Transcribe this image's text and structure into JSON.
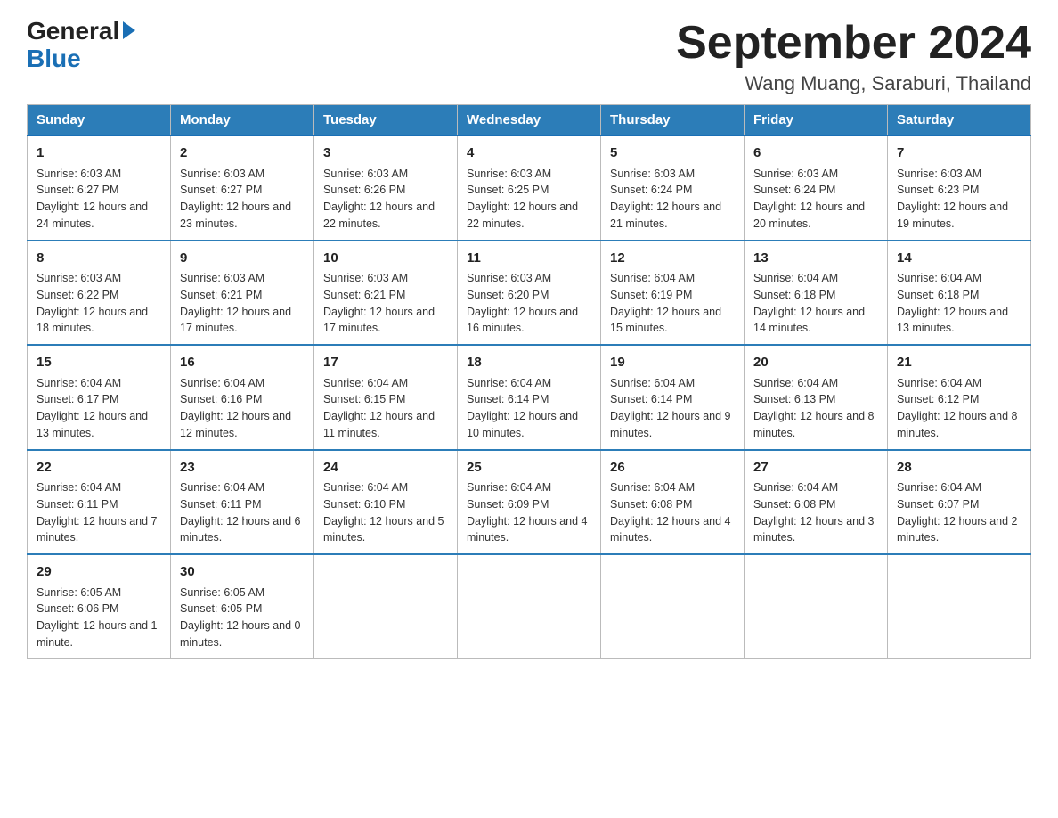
{
  "header": {
    "logo_general": "General",
    "logo_blue": "Blue",
    "month_title": "September 2024",
    "location": "Wang Muang, Saraburi, Thailand"
  },
  "days_of_week": [
    "Sunday",
    "Monday",
    "Tuesday",
    "Wednesday",
    "Thursday",
    "Friday",
    "Saturday"
  ],
  "weeks": [
    [
      {
        "day": "1",
        "sunrise": "Sunrise: 6:03 AM",
        "sunset": "Sunset: 6:27 PM",
        "daylight": "Daylight: 12 hours and 24 minutes."
      },
      {
        "day": "2",
        "sunrise": "Sunrise: 6:03 AM",
        "sunset": "Sunset: 6:27 PM",
        "daylight": "Daylight: 12 hours and 23 minutes."
      },
      {
        "day": "3",
        "sunrise": "Sunrise: 6:03 AM",
        "sunset": "Sunset: 6:26 PM",
        "daylight": "Daylight: 12 hours and 22 minutes."
      },
      {
        "day": "4",
        "sunrise": "Sunrise: 6:03 AM",
        "sunset": "Sunset: 6:25 PM",
        "daylight": "Daylight: 12 hours and 22 minutes."
      },
      {
        "day": "5",
        "sunrise": "Sunrise: 6:03 AM",
        "sunset": "Sunset: 6:24 PM",
        "daylight": "Daylight: 12 hours and 21 minutes."
      },
      {
        "day": "6",
        "sunrise": "Sunrise: 6:03 AM",
        "sunset": "Sunset: 6:24 PM",
        "daylight": "Daylight: 12 hours and 20 minutes."
      },
      {
        "day": "7",
        "sunrise": "Sunrise: 6:03 AM",
        "sunset": "Sunset: 6:23 PM",
        "daylight": "Daylight: 12 hours and 19 minutes."
      }
    ],
    [
      {
        "day": "8",
        "sunrise": "Sunrise: 6:03 AM",
        "sunset": "Sunset: 6:22 PM",
        "daylight": "Daylight: 12 hours and 18 minutes."
      },
      {
        "day": "9",
        "sunrise": "Sunrise: 6:03 AM",
        "sunset": "Sunset: 6:21 PM",
        "daylight": "Daylight: 12 hours and 17 minutes."
      },
      {
        "day": "10",
        "sunrise": "Sunrise: 6:03 AM",
        "sunset": "Sunset: 6:21 PM",
        "daylight": "Daylight: 12 hours and 17 minutes."
      },
      {
        "day": "11",
        "sunrise": "Sunrise: 6:03 AM",
        "sunset": "Sunset: 6:20 PM",
        "daylight": "Daylight: 12 hours and 16 minutes."
      },
      {
        "day": "12",
        "sunrise": "Sunrise: 6:04 AM",
        "sunset": "Sunset: 6:19 PM",
        "daylight": "Daylight: 12 hours and 15 minutes."
      },
      {
        "day": "13",
        "sunrise": "Sunrise: 6:04 AM",
        "sunset": "Sunset: 6:18 PM",
        "daylight": "Daylight: 12 hours and 14 minutes."
      },
      {
        "day": "14",
        "sunrise": "Sunrise: 6:04 AM",
        "sunset": "Sunset: 6:18 PM",
        "daylight": "Daylight: 12 hours and 13 minutes."
      }
    ],
    [
      {
        "day": "15",
        "sunrise": "Sunrise: 6:04 AM",
        "sunset": "Sunset: 6:17 PM",
        "daylight": "Daylight: 12 hours and 13 minutes."
      },
      {
        "day": "16",
        "sunrise": "Sunrise: 6:04 AM",
        "sunset": "Sunset: 6:16 PM",
        "daylight": "Daylight: 12 hours and 12 minutes."
      },
      {
        "day": "17",
        "sunrise": "Sunrise: 6:04 AM",
        "sunset": "Sunset: 6:15 PM",
        "daylight": "Daylight: 12 hours and 11 minutes."
      },
      {
        "day": "18",
        "sunrise": "Sunrise: 6:04 AM",
        "sunset": "Sunset: 6:14 PM",
        "daylight": "Daylight: 12 hours and 10 minutes."
      },
      {
        "day": "19",
        "sunrise": "Sunrise: 6:04 AM",
        "sunset": "Sunset: 6:14 PM",
        "daylight": "Daylight: 12 hours and 9 minutes."
      },
      {
        "day": "20",
        "sunrise": "Sunrise: 6:04 AM",
        "sunset": "Sunset: 6:13 PM",
        "daylight": "Daylight: 12 hours and 8 minutes."
      },
      {
        "day": "21",
        "sunrise": "Sunrise: 6:04 AM",
        "sunset": "Sunset: 6:12 PM",
        "daylight": "Daylight: 12 hours and 8 minutes."
      }
    ],
    [
      {
        "day": "22",
        "sunrise": "Sunrise: 6:04 AM",
        "sunset": "Sunset: 6:11 PM",
        "daylight": "Daylight: 12 hours and 7 minutes."
      },
      {
        "day": "23",
        "sunrise": "Sunrise: 6:04 AM",
        "sunset": "Sunset: 6:11 PM",
        "daylight": "Daylight: 12 hours and 6 minutes."
      },
      {
        "day": "24",
        "sunrise": "Sunrise: 6:04 AM",
        "sunset": "Sunset: 6:10 PM",
        "daylight": "Daylight: 12 hours and 5 minutes."
      },
      {
        "day": "25",
        "sunrise": "Sunrise: 6:04 AM",
        "sunset": "Sunset: 6:09 PM",
        "daylight": "Daylight: 12 hours and 4 minutes."
      },
      {
        "day": "26",
        "sunrise": "Sunrise: 6:04 AM",
        "sunset": "Sunset: 6:08 PM",
        "daylight": "Daylight: 12 hours and 4 minutes."
      },
      {
        "day": "27",
        "sunrise": "Sunrise: 6:04 AM",
        "sunset": "Sunset: 6:08 PM",
        "daylight": "Daylight: 12 hours and 3 minutes."
      },
      {
        "day": "28",
        "sunrise": "Sunrise: 6:04 AM",
        "sunset": "Sunset: 6:07 PM",
        "daylight": "Daylight: 12 hours and 2 minutes."
      }
    ],
    [
      {
        "day": "29",
        "sunrise": "Sunrise: 6:05 AM",
        "sunset": "Sunset: 6:06 PM",
        "daylight": "Daylight: 12 hours and 1 minute."
      },
      {
        "day": "30",
        "sunrise": "Sunrise: 6:05 AM",
        "sunset": "Sunset: 6:05 PM",
        "daylight": "Daylight: 12 hours and 0 minutes."
      },
      null,
      null,
      null,
      null,
      null
    ]
  ]
}
